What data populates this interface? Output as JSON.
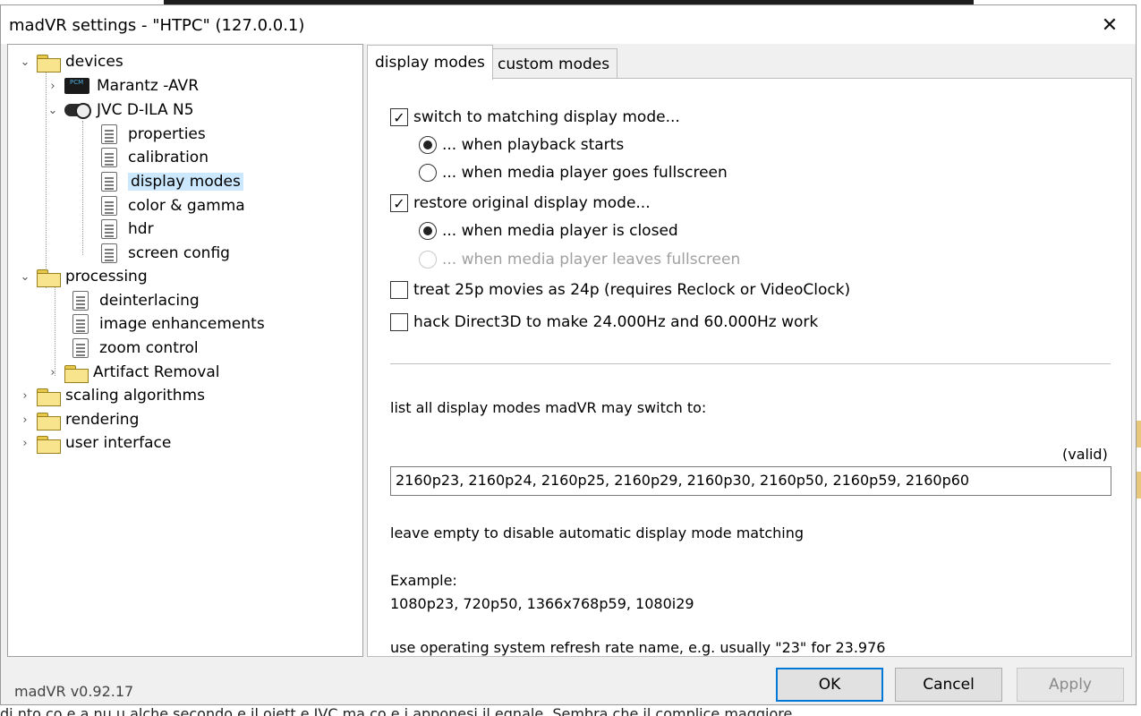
{
  "window": {
    "title": "madVR settings - \"HTPC\" (127.0.0.1)",
    "close_glyph": "✕",
    "version": "madVR v0.92.17"
  },
  "tree": {
    "devices": "devices",
    "marantz": "Marantz -AVR",
    "jvc": "JVC D-ILA N5",
    "properties": "properties",
    "calibration": "calibration",
    "display_modes": "display modes",
    "color_gamma": "color & gamma",
    "hdr": "hdr",
    "screen_config": "screen config",
    "processing": "processing",
    "deinterlacing": "deinterlacing",
    "image_enhancements": "image enhancements",
    "zoom_control": "zoom control",
    "artifact_removal": "Artifact Removal",
    "scaling": "scaling algorithms",
    "rendering": "rendering",
    "user_interface": "user interface"
  },
  "tabs": {
    "display_modes": "display modes",
    "custom_modes": "custom modes"
  },
  "options": {
    "switch_matching": "switch to matching display mode...",
    "when_playback_starts": "... when playback starts",
    "when_fullscreen": "... when media player goes fullscreen",
    "restore_original": "restore original display mode...",
    "when_closed": "... when media player is closed",
    "when_leaves_fullscreen": "... when media player leaves fullscreen",
    "treat_25p": "treat 25p movies as 24p  (requires Reclock or VideoClock)",
    "hack_d3d": "hack Direct3D to make 24.000Hz and 60.000Hz work",
    "check_glyph": "✓"
  },
  "modes": {
    "list_label": "list all display modes madVR may switch to:",
    "valid": "(valid)",
    "value": "2160p23, 2160p24, 2160p25, 2160p29, 2160p30, 2160p50, 2160p59, 2160p60",
    "empty_note": "leave empty to disable automatic display mode matching",
    "example_label": "Example:",
    "example_value": "1080p23, 720p50, 1366x768p59, 1080i29",
    "os_note": "use operating system refresh rate name, e.g. usually \"23\" for 23.976"
  },
  "buttons": {
    "ok": "OK",
    "cancel": "Cancel",
    "apply": "Apply"
  },
  "background": {
    "bottom_text": "di    nto co    e a   nu  u  alche secondo e il    oiett  e JVC  ma co  e  i  apponesi  il  egnale. Sembra che il complice maggiore"
  }
}
